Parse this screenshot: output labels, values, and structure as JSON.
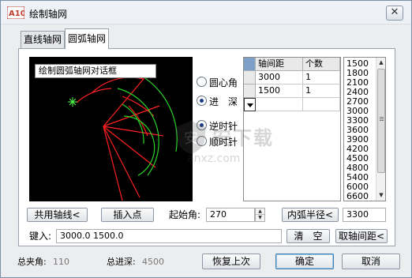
{
  "window": {
    "title": "绘制轴网",
    "app_icon_text": "A10",
    "close_symbol": "✕"
  },
  "tabs": [
    {
      "label": "直线轴网",
      "active": false
    },
    {
      "label": "圆弧轴网",
      "active": true
    }
  ],
  "preview": {
    "label": "绘制圆弧轴网对话框"
  },
  "options": {
    "mode": [
      {
        "label": "圆心角",
        "selected": false
      },
      {
        "label": "进　深",
        "selected": true
      }
    ],
    "direction": [
      {
        "label": "逆时针",
        "selected": true
      },
      {
        "label": "顺时针",
        "selected": false
      }
    ]
  },
  "grid": {
    "headers": [
      "轴间距",
      "个数"
    ],
    "rows": [
      [
        "3000",
        "1"
      ],
      [
        "1500",
        "1"
      ]
    ]
  },
  "value_list": [
    "1500",
    "1800",
    "2100",
    "2400",
    "2700",
    "3000",
    "3300",
    "3600",
    "3900",
    "4200",
    "4500",
    "4800",
    "5400",
    "6000",
    "6600"
  ],
  "controls": {
    "shared_axis_label": "共用轴线<",
    "insert_point_label": "插入点",
    "start_angle_label": "起始角:",
    "start_angle_value": "270",
    "inner_radius_label": "内弧半径<",
    "inner_radius_value": "3300",
    "input_label": "键入:",
    "input_value": "3000.0 1500.0",
    "clear_label": "清　空",
    "pick_spacing_label": "取轴间距<"
  },
  "footer": {
    "total_angle_label": "总夹角:",
    "total_angle_value": "110",
    "total_depth_label": "总进深:",
    "total_depth_value": "4500",
    "restore_label": "恢复上次",
    "ok_label": "确定",
    "cancel_label": "取消"
  },
  "watermark": {
    "text1": "安下载",
    "text2": "anxz.com"
  },
  "colors": {
    "preview_bg": "#000000",
    "axis_red": "#ff2020",
    "arc_green": "#28d428",
    "marker_green": "#50ff50"
  }
}
